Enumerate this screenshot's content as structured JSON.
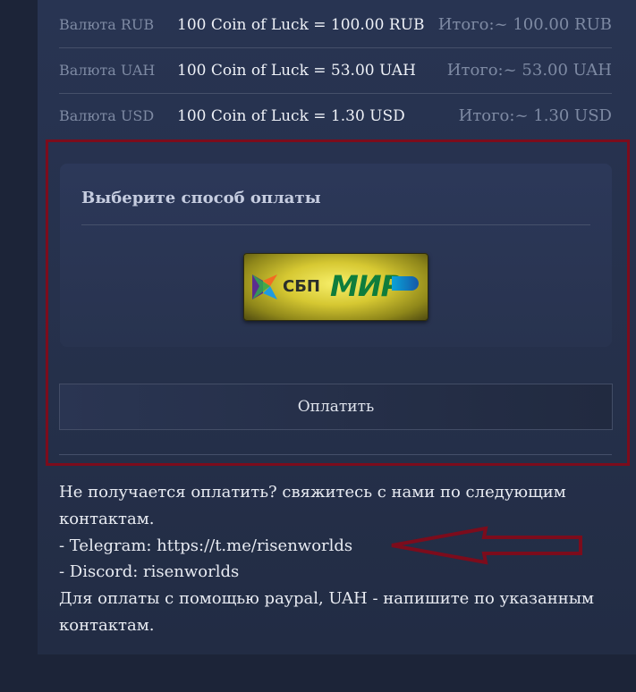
{
  "rates": [
    {
      "currency": "Валюта RUB",
      "conversion": "100 Coin of Luck = 100.00 RUB",
      "total": "Итого:~ 100.00 RUB"
    },
    {
      "currency": "Валюта UAH",
      "conversion": "100 Coin of Luck = 53.00 UAH",
      "total": "Итого:~ 53.00 UAH"
    },
    {
      "currency": "Валюта USD",
      "conversion": "100 Coin of Luck = 1.30 USD",
      "total": "Итого:~ 1.30 USD"
    }
  ],
  "payment": {
    "title": "Выберите способ оплаты",
    "method_sbp": "СБП",
    "method_mir": "МИР",
    "pay_button": "Оплатить"
  },
  "contact": {
    "line1": "Не получается оплатить? свяжитесь с нами по следующим",
    "line2": "контактам.",
    "line3": "- Telegram:  https://t.me/risenworlds",
    "line4": "- Discord: risenworlds",
    "line5": "Для оплаты с помощью paypal, UAH - напишите по указанным",
    "line6": "контактам."
  },
  "colors": {
    "highlight_frame": "#7c0c1c",
    "background": "#1c2438",
    "panel": "#283452"
  }
}
